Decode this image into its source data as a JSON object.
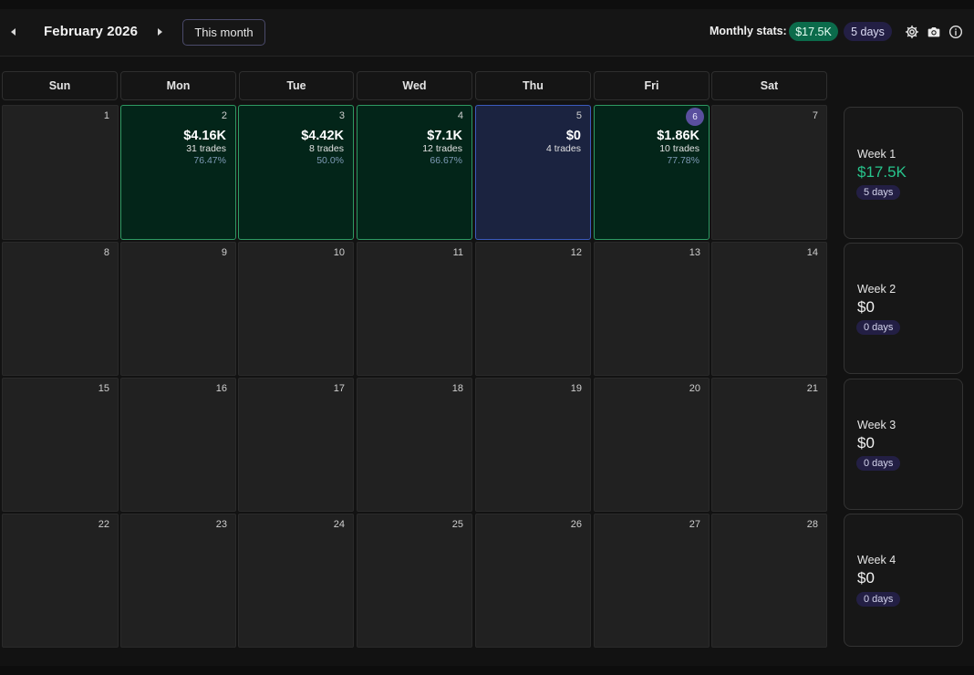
{
  "header": {
    "prev_icon": "caret-left-icon",
    "next_icon": "caret-right-icon",
    "title": "February 2026",
    "this_month_label": "This month",
    "stats_label": "Monthly stats:",
    "stats_pnl": "$17.5K",
    "stats_days": "5 days",
    "icons": [
      "gear-icon",
      "camera-icon",
      "info-icon"
    ],
    "colors": {
      "positive": "#27c48c",
      "win_bg": "#032519",
      "win_border": "#2e9a63",
      "even_bg": "#1b2340",
      "even_border": "#3b5bbd",
      "badge_bg": "#231f44"
    }
  },
  "weekdays": [
    "Sun",
    "Mon",
    "Tue",
    "Wed",
    "Thu",
    "Fri",
    "Sat"
  ],
  "weeks": [
    {
      "days": [
        {
          "day": "1"
        },
        {
          "day": "2",
          "status": "win",
          "pnl": "$4.16K",
          "trades": "31 trades",
          "winrate": "76.47%"
        },
        {
          "day": "3",
          "status": "win",
          "pnl": "$4.42K",
          "trades": "8 trades",
          "winrate": "50.0%"
        },
        {
          "day": "4",
          "status": "win",
          "pnl": "$7.1K",
          "trades": "12 trades",
          "winrate": "66.67%"
        },
        {
          "day": "5",
          "status": "even",
          "pnl": "$0",
          "trades": "4 trades"
        },
        {
          "day": "6",
          "status": "win",
          "today": true,
          "pnl": "$1.86K",
          "trades": "10 trades",
          "winrate": "77.78%"
        },
        {
          "day": "7"
        }
      ],
      "summary": {
        "label": "Week 1",
        "pnl": "$17.5K",
        "days": "5 days",
        "positive": true
      }
    },
    {
      "days": [
        {
          "day": "8"
        },
        {
          "day": "9"
        },
        {
          "day": "10"
        },
        {
          "day": "11"
        },
        {
          "day": "12"
        },
        {
          "day": "13"
        },
        {
          "day": "14"
        }
      ],
      "summary": {
        "label": "Week 2",
        "pnl": "$0",
        "days": "0 days",
        "positive": false
      }
    },
    {
      "days": [
        {
          "day": "15"
        },
        {
          "day": "16"
        },
        {
          "day": "17"
        },
        {
          "day": "18"
        },
        {
          "day": "19"
        },
        {
          "day": "20"
        },
        {
          "day": "21"
        }
      ],
      "summary": {
        "label": "Week 3",
        "pnl": "$0",
        "days": "0 days",
        "positive": false
      }
    },
    {
      "days": [
        {
          "day": "22"
        },
        {
          "day": "23"
        },
        {
          "day": "24"
        },
        {
          "day": "25"
        },
        {
          "day": "26"
        },
        {
          "day": "27"
        },
        {
          "day": "28"
        }
      ],
      "summary": {
        "label": "Week 4",
        "pnl": "$0",
        "days": "0 days",
        "positive": false
      }
    }
  ]
}
